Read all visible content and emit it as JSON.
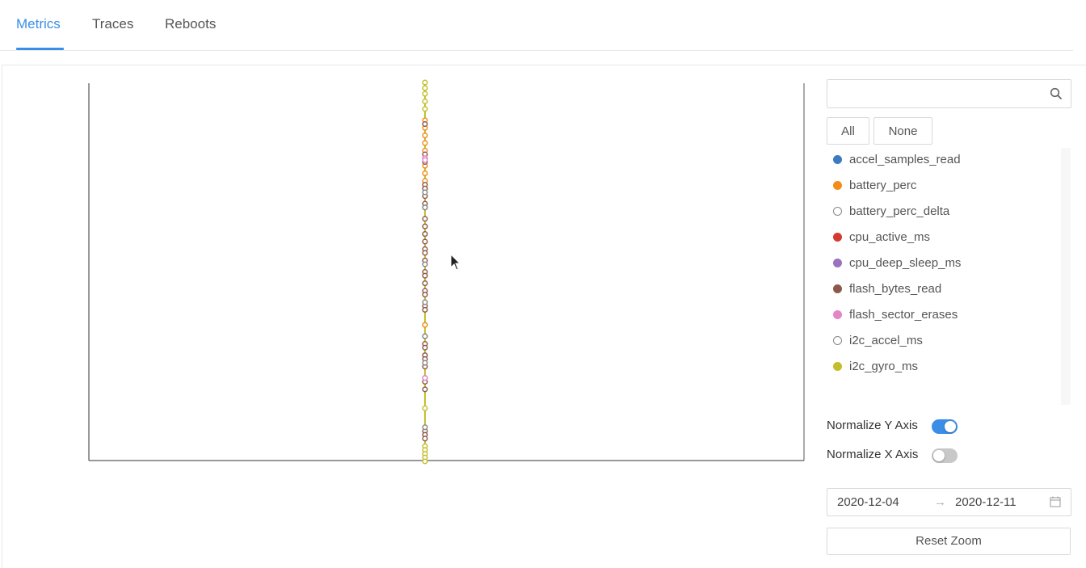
{
  "tabs": [
    {
      "label": "Metrics",
      "active": true
    },
    {
      "label": "Traces",
      "active": false
    },
    {
      "label": "Reboots",
      "active": false
    }
  ],
  "search": {
    "placeholder": "",
    "icon": "search-icon"
  },
  "select_buttons": {
    "all": "All",
    "none": "None"
  },
  "metrics": [
    {
      "name": "accel_samples_read",
      "color": "#3b7bbf",
      "hollow": false
    },
    {
      "name": "battery_perc",
      "color": "#f28c1a",
      "hollow": false
    },
    {
      "name": "battery_perc_delta",
      "color": "#888888",
      "hollow": true
    },
    {
      "name": "cpu_active_ms",
      "color": "#d23b2f",
      "hollow": false
    },
    {
      "name": "cpu_deep_sleep_ms",
      "color": "#9a72c0",
      "hollow": false
    },
    {
      "name": "flash_bytes_read",
      "color": "#8b5a4a",
      "hollow": false
    },
    {
      "name": "flash_sector_erases",
      "color": "#e485c7",
      "hollow": false
    },
    {
      "name": "i2c_accel_ms",
      "color": "#888888",
      "hollow": true
    },
    {
      "name": "i2c_gyro_ms",
      "color": "#c4be2c",
      "hollow": false
    }
  ],
  "toggles": {
    "normalize_y": {
      "label": "Normalize Y Axis",
      "on": true
    },
    "normalize_x": {
      "label": "Normalize X Axis",
      "on": false
    }
  },
  "date_range": {
    "start": "2020-12-04",
    "end": "2020-12-11",
    "separator": "→"
  },
  "reset_zoom": "Reset Zoom",
  "colors": {
    "accent": "#3a8ee6",
    "switch_off": "#c8c8c8",
    "line": "#c4be2c"
  },
  "chart_data": {
    "type": "scatter",
    "title": "",
    "xlabel": "",
    "ylabel": "",
    "grid": false,
    "x_position": 0.47,
    "series": [
      {
        "name": "i2c_gyro_ms",
        "color": "#c4be2c",
        "hollow": true,
        "y": [
          1.0,
          0.985,
          0.97,
          0.95,
          0.93,
          0.62,
          0.4,
          0.36,
          0.14,
          0.04,
          0.03,
          0.02,
          0.01,
          0.0
        ]
      },
      {
        "name": "battery_perc",
        "color": "#f28c1a",
        "hollow": true,
        "y": [
          0.9,
          0.88,
          0.86,
          0.84,
          0.82,
          0.8,
          0.78,
          0.76,
          0.74,
          0.72,
          0.36
        ]
      },
      {
        "name": "flash_bytes_read",
        "color": "#8b5a4a",
        "hollow": true,
        "y": [
          0.89,
          0.81,
          0.79,
          0.73,
          0.72,
          0.7,
          0.68,
          0.67,
          0.64,
          0.62,
          0.6,
          0.58,
          0.56,
          0.55,
          0.53,
          0.5,
          0.49,
          0.47,
          0.45,
          0.44,
          0.41,
          0.4,
          0.33,
          0.31,
          0.3,
          0.28,
          0.27,
          0.25,
          0.22,
          0.21,
          0.19,
          0.08,
          0.07,
          0.06
        ]
      },
      {
        "name": "flash_sector_erases",
        "color": "#e485c7",
        "hollow": true,
        "y": [
          0.8,
          0.795,
          0.22
        ]
      },
      {
        "name": "battery_perc_delta",
        "color": "#888888",
        "hollow": true,
        "y": [
          0.71,
          0.67,
          0.52,
          0.42,
          0.33,
          0.26,
          0.09
        ]
      }
    ]
  }
}
